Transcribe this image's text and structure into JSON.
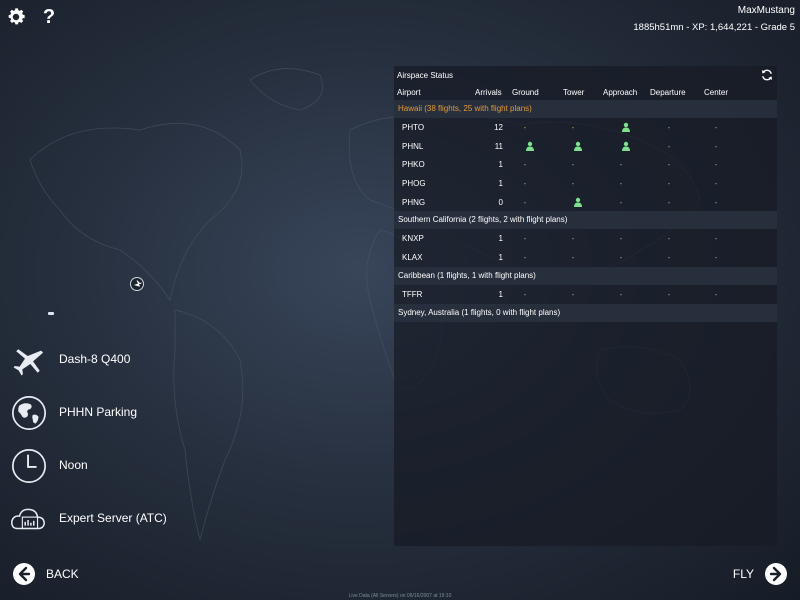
{
  "header": {
    "username": "MaxMustang",
    "stats": "1885h51mn - XP: 1,644,221 - Grade 5"
  },
  "help_label": "?",
  "airspace": {
    "title": "Airspace Status",
    "columns": [
      "Airport",
      "Arrivals",
      "Ground",
      "Tower",
      "Approach",
      "Departure",
      "Center"
    ],
    "regions": [
      {
        "name": "Hawaii (38 flights, 25 with flight plans)",
        "highlight": true,
        "airports": [
          {
            "code": "PHTO",
            "arrivals": "12",
            "ground": "orange-dash",
            "tower": "orange-dash",
            "approach": "person",
            "departure": "dash",
            "center": "dash"
          },
          {
            "code": "PHNL",
            "arrivals": "11",
            "ground": "person",
            "tower": "person",
            "approach": "person",
            "departure": "dash",
            "center": "dash"
          },
          {
            "code": "PHKO",
            "arrivals": "1",
            "ground": "dash",
            "tower": "dash",
            "approach": "dash",
            "departure": "dash",
            "center": "dash"
          },
          {
            "code": "PHOG",
            "arrivals": "1",
            "ground": "dash",
            "tower": "dash",
            "approach": "dash",
            "departure": "dash",
            "center": "dash"
          },
          {
            "code": "PHNG",
            "arrivals": "0",
            "ground": "dash",
            "tower": "person",
            "approach": "dash",
            "departure": "dash",
            "center": "dash"
          }
        ]
      },
      {
        "name": "Southern California (2 flights, 2 with flight plans)",
        "highlight": false,
        "airports": [
          {
            "code": "KNXP",
            "arrivals": "1",
            "ground": "dash",
            "tower": "dash",
            "approach": "dash",
            "departure": "dash",
            "center": "dash"
          },
          {
            "code": "KLAX",
            "arrivals": "1",
            "ground": "dash",
            "tower": "dash",
            "approach": "dash",
            "departure": "dash",
            "center": "dash"
          }
        ]
      },
      {
        "name": "Caribbean (1 flights, 1 with flight plans)",
        "highlight": false,
        "airports": [
          {
            "code": "TFFR",
            "arrivals": "1",
            "ground": "dash",
            "tower": "dash",
            "approach": "dash",
            "departure": "dash",
            "center": "dash"
          }
        ]
      },
      {
        "name": "Sydney, Australia (1 flights, 0 with flight plans)",
        "highlight": false,
        "airports": []
      }
    ]
  },
  "menu": {
    "aircraft": "Dash-8 Q400",
    "location": "PHHN Parking",
    "time": "Noon",
    "server": "Expert Server (ATC)"
  },
  "nav": {
    "back": "BACK",
    "fly": "FLY"
  },
  "footer": "Live Data (All Servers) on 06/16/2007 at 19:10",
  "colors": {
    "accent_orange": "#e29a3d",
    "atc_green": "#7ee08a"
  }
}
